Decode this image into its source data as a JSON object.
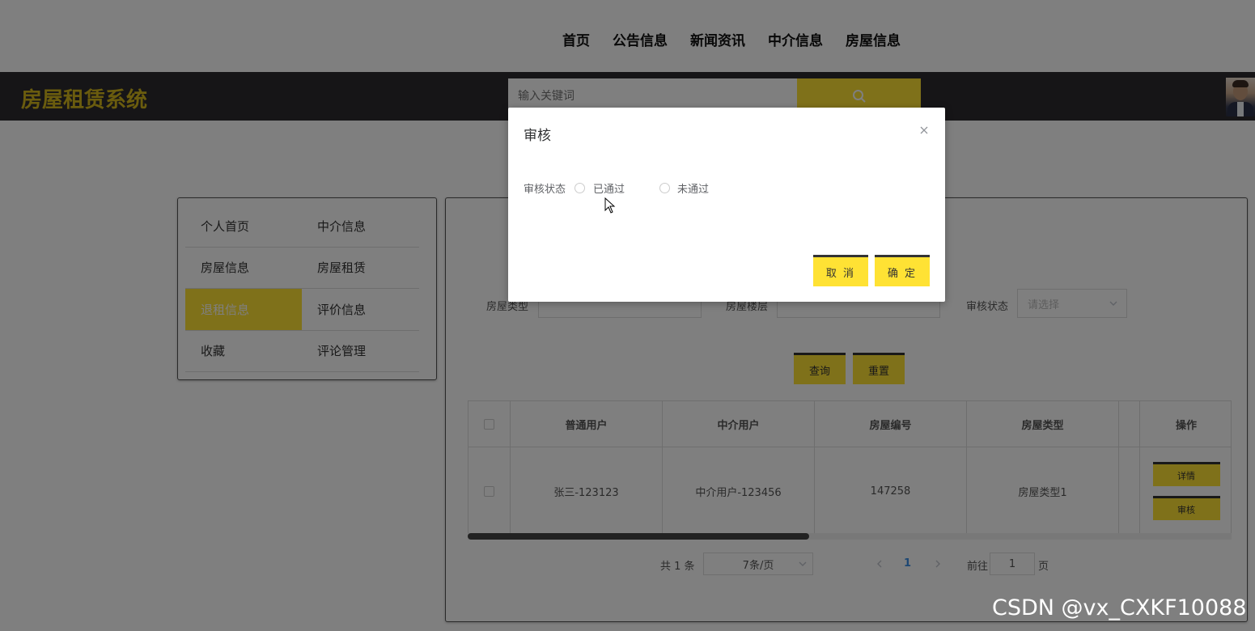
{
  "topnav": {
    "items": [
      "首页",
      "公告信息",
      "新闻资讯",
      "中介信息",
      "房屋信息"
    ]
  },
  "header": {
    "brand": "房屋租赁系统",
    "search_placeholder": "输入关键词"
  },
  "sidebar": {
    "items": [
      "个人首页",
      "中介信息",
      "房屋信息",
      "房屋租赁",
      "退租信息",
      "评价信息",
      "收藏",
      "评论管理"
    ],
    "active": "退租信息"
  },
  "filters": {
    "house_type_label": "房屋类型",
    "house_floor_label": "房屋楼层",
    "review_status_label": "审核状态",
    "review_status_placeholder": "请选择",
    "query_label": "查询",
    "reset_label": "重置"
  },
  "table": {
    "columns": [
      "普通用户",
      "中介用户",
      "房屋编号",
      "房屋类型",
      "操作"
    ],
    "rows": [
      {
        "user": "张三-123123",
        "agent": "中介用户-123456",
        "house_no": "147258",
        "house_type": "房屋类型1"
      }
    ],
    "actions": {
      "detail": "详情",
      "review": "审核"
    }
  },
  "pagination": {
    "total": "共 1 条",
    "page_size": "7条/页",
    "current": "1",
    "goto_label": "前往",
    "goto_value": "1",
    "page_unit": "页"
  },
  "dialog": {
    "title": "审核",
    "field_label": "审核状态",
    "options": [
      "已通过",
      "未通过"
    ],
    "cancel_label": "取 消",
    "confirm_label": "确 定"
  },
  "watermark": "CSDN @vx_CXKF10088",
  "colors": {
    "accent": "#ffe234",
    "header_bg": "#2d2a2e",
    "brand": "#d4b81c",
    "link": "#3a8ee6"
  }
}
